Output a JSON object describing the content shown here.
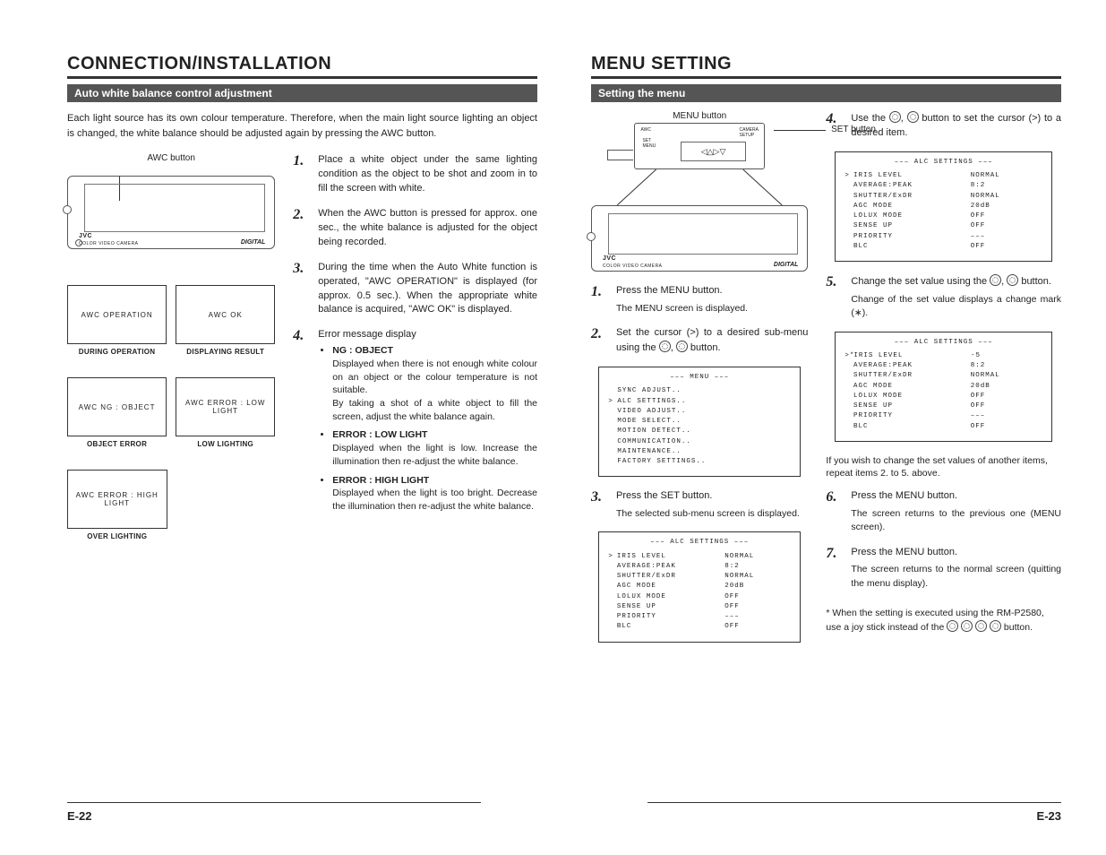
{
  "left": {
    "heading": "CONNECTION/INSTALLATION",
    "subheading": "Auto white balance control adjustment",
    "intro": "Each light source has its own colour temperature. Therefore, when the main light source lighting an object is changed, the white balance should be adjusted again by pressing the AWC button.",
    "awc_label": "AWC button",
    "cam": {
      "brand": "JVC",
      "sub": "COLOR VIDEO CAMERA",
      "digital": "DIGITAL"
    },
    "disp": {
      "a1": "AWC   OPERATION",
      "a1c": "DURING OPERATION",
      "a2": "AWC    OK",
      "a2c": "DISPLAYING RESULT",
      "b1": "AWC   NG : OBJECT",
      "b1c": "OBJECT ERROR",
      "b2": "AWC   ERROR : LOW LIGHT",
      "b2c": "LOW LIGHTING",
      "c1": "AWC   ERROR : HIGH LIGHT",
      "c1c": "OVER LIGHTING"
    },
    "steps": {
      "s1": "Place a white object under the same lighting condition as the object to be shot and zoom in to fill the screen with white.",
      "s2": "When the AWC button is pressed for approx. one sec., the white balance is adjusted for the object being recorded.",
      "s3": "During the time when the Auto White function is operated, \"AWC OPERATION\" is displayed (for approx. 0.5 sec.). When the appropriate white balance is acquired, \"AWC OK\" is displayed.",
      "s4_head": "Error message display",
      "s4a_t": "NG : OBJECT",
      "s4a": "Displayed when there is not enough white colour on an object or the colour temperature is not suitable.\nBy taking a shot of a white object to fill the screen, adjust the white balance again.",
      "s4b_t": "ERROR : LOW LIGHT",
      "s4b": "Displayed when the light is low. Increase the illumination then re-adjust the white balance.",
      "s4c_t": "ERROR : HIGH LIGHT",
      "s4c": "Displayed when the light is too bright. Decrease the illumination then re-adjust the white balance."
    },
    "pagenum": "E-22"
  },
  "right": {
    "heading": "MENU SETTING",
    "subheading": "Setting the menu",
    "labels": {
      "menu_btn": "MENU button",
      "set_btn": "SET button"
    },
    "cam": {
      "brand": "JVC",
      "sub": "COLOR VIDEO CAMERA",
      "digital": "DIGITAL"
    },
    "steps": {
      "s1": "Press the MENU button.",
      "s1b": "The MENU screen is displayed.",
      "s2": "Set the cursor (>) to a desired sub-menu using the ",
      "s2b": " button.",
      "s3": "Press the SET button.",
      "s3b": "The selected sub-menu screen is displayed.",
      "s4": "Use the ",
      "s4b": " button to set the cursor (>) to a desired item.",
      "s5": "Change the set value using the ",
      "s5b": " button.",
      "s5c": "Change of the set value displays a change mark (∗).",
      "s5d": "If you wish to change the set values of another items, repeat items 2. to 5. above.",
      "s6": "Press the MENU button.",
      "s6b": "The screen returns to the previous one (MENU screen).",
      "s7": "Press the MENU button.",
      "s7b": "The screen returns to the normal screen (quitting the menu display).",
      "note": "* When the setting is executed using the RM-P2580, use a joy stick instead of the ",
      "note2": " button."
    },
    "menu_main": {
      "title": "––– MENU –––",
      "items": [
        "SYNC ADJUST..",
        "ALC SETTINGS..",
        "VIDEO ADJUST..",
        "MODE SELECT..",
        "MOTION DETECT..",
        "COMMUNICATION..",
        "MAINTENANCE..",
        "FACTORY SETTINGS.."
      ],
      "cursor_index": 1
    },
    "alc": {
      "title": "––– ALC SETTINGS –––",
      "rows": [
        {
          "k": "IRIS LEVEL",
          "v": "NORMAL"
        },
        {
          "k": "AVERAGE:PEAK",
          "v": "8:2"
        },
        {
          "k": "SHUTTER/ExDR",
          "v": "NORMAL"
        },
        {
          "k": "AGC MODE",
          "v": "20dB"
        },
        {
          "k": "LOLUX MODE",
          "v": "OFF"
        },
        {
          "k": "SENSE UP",
          "v": "OFF"
        },
        {
          "k": "PRIORITY",
          "v": "–––"
        },
        {
          "k": "BLC",
          "v": "OFF"
        }
      ]
    },
    "alc2": {
      "title": "––– ALC SETTINGS –––",
      "rows": [
        {
          "k": "IRIS LEVEL",
          "v": "-5"
        },
        {
          "k": "AVERAGE:PEAK",
          "v": "8:2"
        },
        {
          "k": "SHUTTER/ExDR",
          "v": "NORMAL"
        },
        {
          "k": "AGC MODE",
          "v": "20dB"
        },
        {
          "k": "LOLUX MODE",
          "v": "OFF"
        },
        {
          "k": "SENSE UP",
          "v": "OFF"
        },
        {
          "k": "PRIORITY",
          "v": "–––"
        },
        {
          "k": "BLC",
          "v": "OFF"
        }
      ]
    },
    "pagenum": "E-23"
  }
}
